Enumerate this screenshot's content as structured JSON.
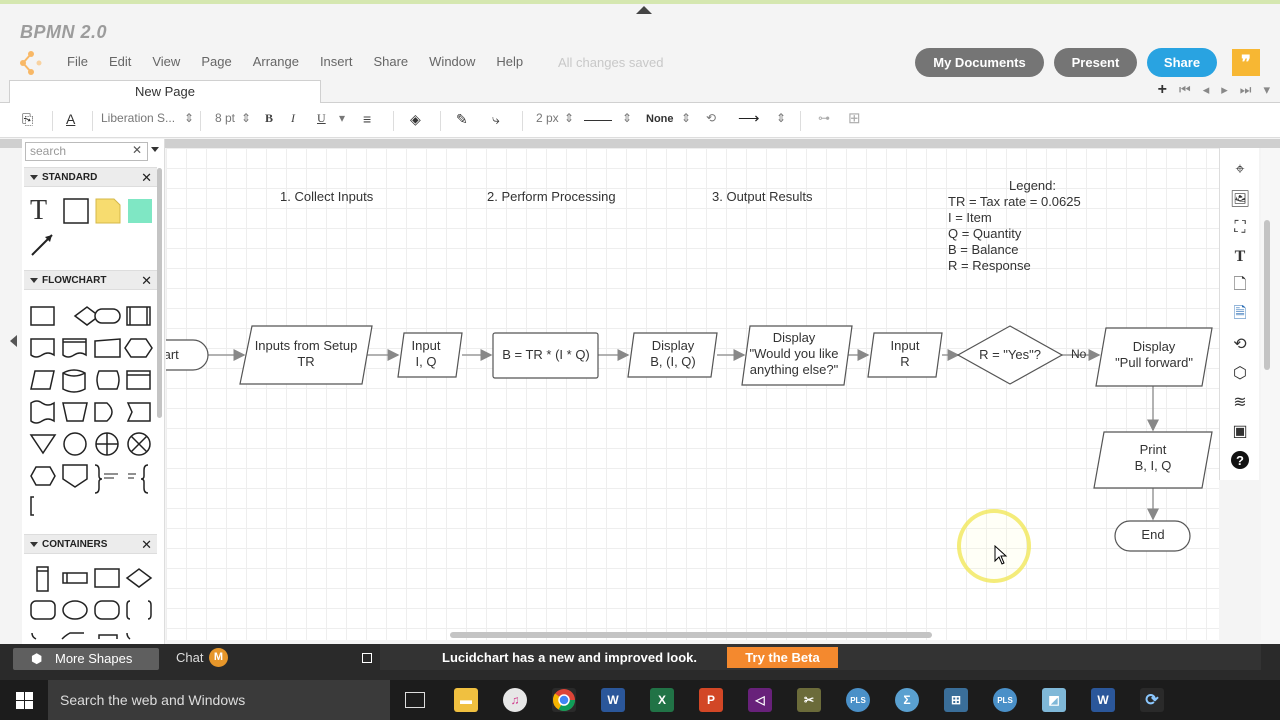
{
  "app": {
    "doc_title": "BPMN 2.0",
    "menu": [
      "File",
      "Edit",
      "View",
      "Page",
      "Arrange",
      "Insert",
      "Share",
      "Window",
      "Help"
    ],
    "save_status": "All changes saved",
    "buttons": {
      "my_documents": "My Documents",
      "present": "Present",
      "share": "Share"
    },
    "feedback_icon": "quote-icon"
  },
  "tabs": {
    "active": "New Page"
  },
  "toolbar": {
    "font_family": "Liberation S...",
    "font_size": "8 pt",
    "bold": "B",
    "italic": "I",
    "underline": "U",
    "line_width": "2 px",
    "arrow_start": "None"
  },
  "left_panel": {
    "search_placeholder": "search",
    "sections": {
      "standard": "STANDARD",
      "flowchart": "FLOWCHART",
      "containers": "CONTAINERS"
    }
  },
  "diagram": {
    "phases": [
      "1. Collect Inputs",
      "2. Perform Processing",
      "3. Output Results"
    ],
    "legend": {
      "title": "Legend:",
      "lines": [
        "TR = Tax rate = 0.0625",
        "I = Item",
        "Q = Quantity",
        "B = Balance",
        "R = Response"
      ]
    },
    "nodes": {
      "start": "tart",
      "setup": [
        "Inputs from Setup",
        "TR"
      ],
      "input_iq": [
        "Input",
        "I, Q"
      ],
      "process": "B = TR * (I * Q)",
      "display_biq": [
        "Display",
        "B, (I, Q)"
      ],
      "display_ask": [
        "Display",
        "\"Would you like",
        "anything else?\""
      ],
      "input_r": [
        "Input",
        "R"
      ],
      "decision": "R = \"Yes\"?",
      "no_label": "No",
      "display_pull": [
        "Display",
        "\"Pull forward\""
      ],
      "print": [
        "Print",
        "B, I, Q"
      ],
      "end": "End"
    }
  },
  "bottom": {
    "more_shapes": "More Shapes",
    "chat": "Chat",
    "chat_avatar": "M",
    "notice": "Lucidchart has a new and improved look.",
    "notice_button": "Try the Beta"
  },
  "taskbar": {
    "search_placeholder": "Search the web and Windows"
  }
}
